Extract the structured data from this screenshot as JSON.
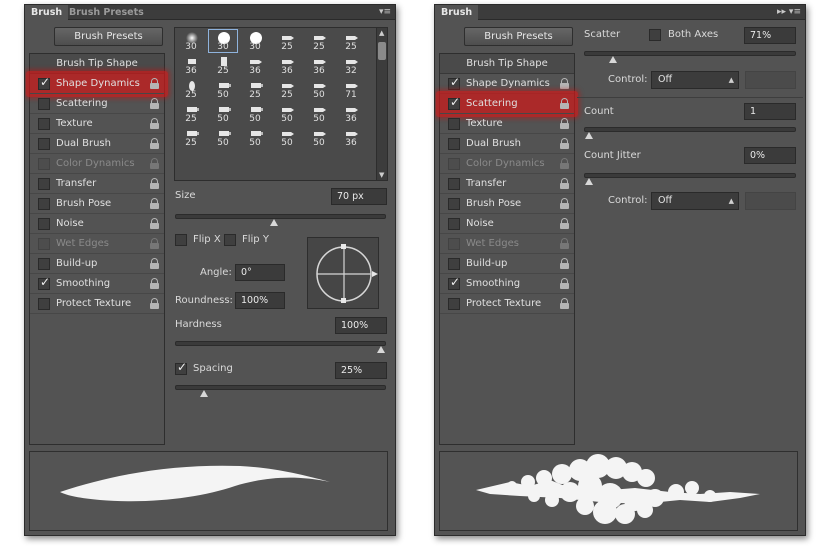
{
  "left_panel": {
    "tabs": [
      "Brush",
      "Brush Presets"
    ],
    "menu_icon": "▾≡",
    "presets_button": "Brush Presets",
    "options": [
      {
        "label": "Brush Tip Shape",
        "checked": false,
        "header": true
      },
      {
        "label": "Shape Dynamics",
        "checked": true,
        "highlight": true
      },
      {
        "label": "Scattering",
        "checked": false
      },
      {
        "label": "Texture",
        "checked": false
      },
      {
        "label": "Dual Brush",
        "checked": false
      },
      {
        "label": "Color Dynamics",
        "checked": false,
        "disabled": true
      },
      {
        "label": "Transfer",
        "checked": false
      },
      {
        "label": "Brush Pose",
        "checked": false
      },
      {
        "label": "Noise",
        "checked": false
      },
      {
        "label": "Wet Edges",
        "checked": false,
        "disabled": true
      },
      {
        "label": "Build-up",
        "checked": false
      },
      {
        "label": "Smoothing",
        "checked": true
      },
      {
        "label": "Protect Texture",
        "checked": false
      }
    ],
    "brush_sizes": [
      "30",
      "30",
      "30",
      "25",
      "25",
      "25",
      "36",
      "25",
      "36",
      "36",
      "36",
      "32",
      "25",
      "50",
      "25",
      "25",
      "50",
      "71",
      "25",
      "50",
      "50",
      "50",
      "50",
      "36",
      "25",
      "50",
      "50",
      "50",
      "50",
      "36"
    ],
    "size": {
      "label": "Size",
      "value": "70 px",
      "slider": 0.47
    },
    "flip_x": {
      "label": "Flip X",
      "checked": false
    },
    "flip_y": {
      "label": "Flip Y",
      "checked": false
    },
    "angle": {
      "label": "Angle:",
      "value": "0°"
    },
    "roundness": {
      "label": "Roundness:",
      "value": "100%"
    },
    "hardness": {
      "label": "Hardness",
      "value": "100%",
      "slider": 1.0
    },
    "spacing": {
      "label": "Spacing",
      "value": "25%",
      "checked": true,
      "slider": 0.12
    }
  },
  "right_panel": {
    "tab": "Brush",
    "menu_icon": "▸▸ ▾≡",
    "presets_button": "Brush Presets",
    "options": [
      {
        "label": "Brush Tip Shape",
        "checked": false,
        "header": true
      },
      {
        "label": "Shape Dynamics",
        "checked": true
      },
      {
        "label": "Scattering",
        "checked": true,
        "highlight": true
      },
      {
        "label": "Texture",
        "checked": false
      },
      {
        "label": "Dual Brush",
        "checked": false
      },
      {
        "label": "Color Dynamics",
        "checked": false,
        "disabled": true
      },
      {
        "label": "Transfer",
        "checked": false
      },
      {
        "label": "Brush Pose",
        "checked": false
      },
      {
        "label": "Noise",
        "checked": false
      },
      {
        "label": "Wet Edges",
        "checked": false,
        "disabled": true
      },
      {
        "label": "Build-up",
        "checked": false
      },
      {
        "label": "Smoothing",
        "checked": true
      },
      {
        "label": "Protect Texture",
        "checked": false
      }
    ],
    "scatter": {
      "label": "Scatter",
      "both_axes_label": "Both Axes",
      "both_axes": false,
      "value": "71%",
      "slider": 0.12
    },
    "control_1": {
      "label": "Control:",
      "value": "Off"
    },
    "count": {
      "label": "Count",
      "value": "1",
      "slider": 0.0
    },
    "count_jitter": {
      "label": "Count Jitter",
      "value": "0%",
      "slider": 0.0
    },
    "control_2": {
      "label": "Control:",
      "value": "Off"
    }
  }
}
